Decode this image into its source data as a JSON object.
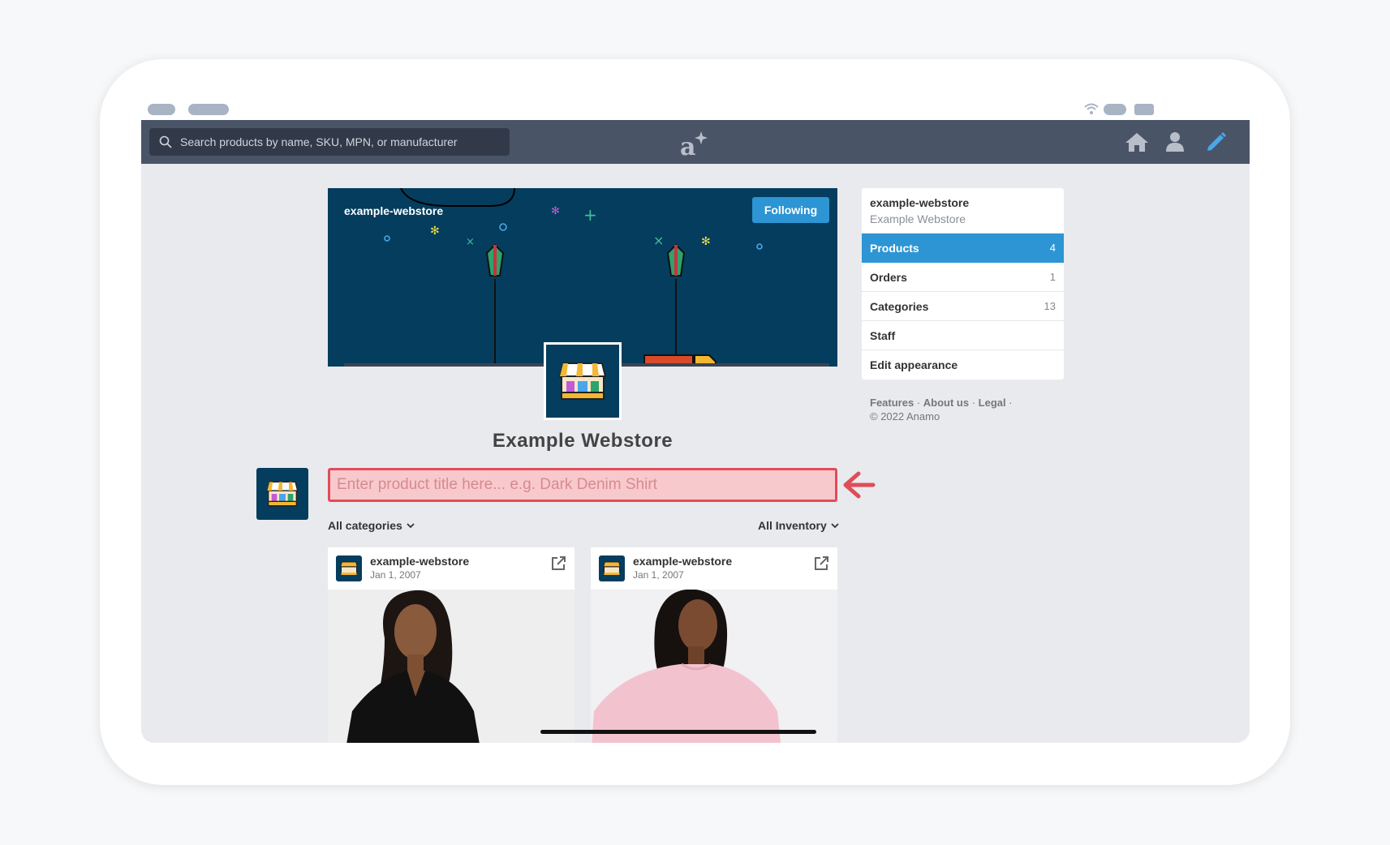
{
  "search": {
    "placeholder": "Search products by name, SKU, MPN, or manufacturer"
  },
  "banner": {
    "store_handle": "example-webstore",
    "follow_label": "Following"
  },
  "store": {
    "title": "Example Webstore"
  },
  "composer": {
    "placeholder": "Enter product title here... e.g. Dark Denim Shirt"
  },
  "filters": {
    "categories_label": "All categories",
    "inventory_label": "All Inventory"
  },
  "cards": [
    {
      "store": "example-webstore",
      "date": "Jan 1, 2007"
    },
    {
      "store": "example-webstore",
      "date": "Jan 1, 2007"
    }
  ],
  "sidebar": {
    "handle": "example-webstore",
    "name": "Example Webstore",
    "items": [
      {
        "label": "Products",
        "count": "4"
      },
      {
        "label": "Orders",
        "count": "1"
      },
      {
        "label": "Categories",
        "count": "13"
      },
      {
        "label": "Staff",
        "count": ""
      },
      {
        "label": "Edit appearance",
        "count": ""
      }
    ]
  },
  "footer": {
    "links": [
      "Features",
      "About us",
      "Legal"
    ],
    "copyright": "© 2022 Anamo"
  },
  "colors": {
    "topbar": "#4a5467",
    "accent": "#2d95d3",
    "banner": "#053d5e",
    "highlight_border": "#df4d58",
    "highlight_fill": "#f8c9cc"
  }
}
